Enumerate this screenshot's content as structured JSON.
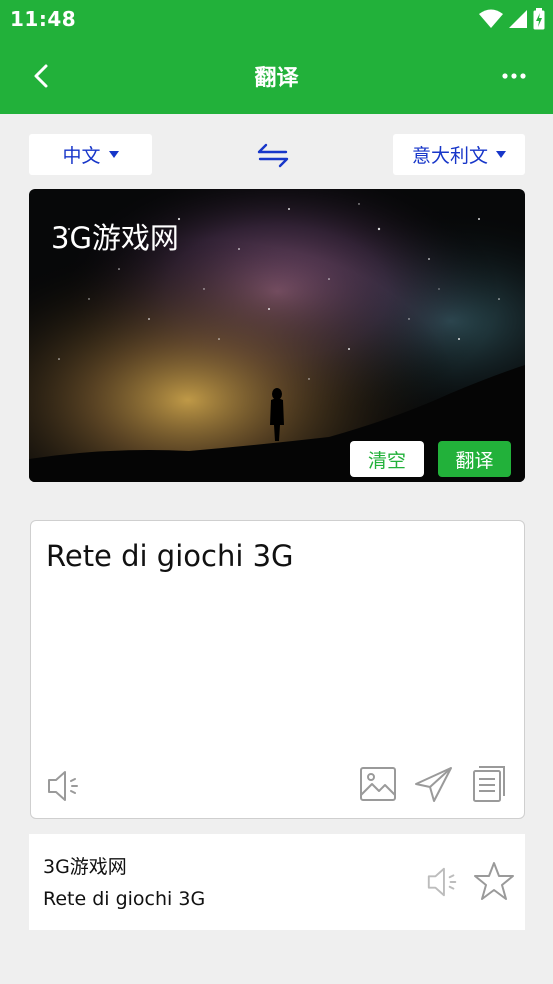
{
  "status_bar": {
    "time": "11:48"
  },
  "app_bar": {
    "title": "翻译"
  },
  "languages": {
    "source": "中文",
    "target": "意大利文"
  },
  "input": {
    "text": "3G游戏网"
  },
  "actions": {
    "clear_label": "清空",
    "translate_label": "翻译"
  },
  "result": {
    "text": "Rete di giochi 3G"
  },
  "history": [
    {
      "source": "3G游戏网",
      "translation": "Rete di giochi 3G"
    }
  ],
  "colors": {
    "brand_green": "#22b13a",
    "language_blue": "#1736c9",
    "icon_gray": "#9a9a9a"
  },
  "icons": [
    "back-arrow-icon",
    "more-vertical-icon",
    "swap-icon",
    "speaker-icon",
    "image-icon",
    "send-icon",
    "copy-icon",
    "star-icon"
  ]
}
